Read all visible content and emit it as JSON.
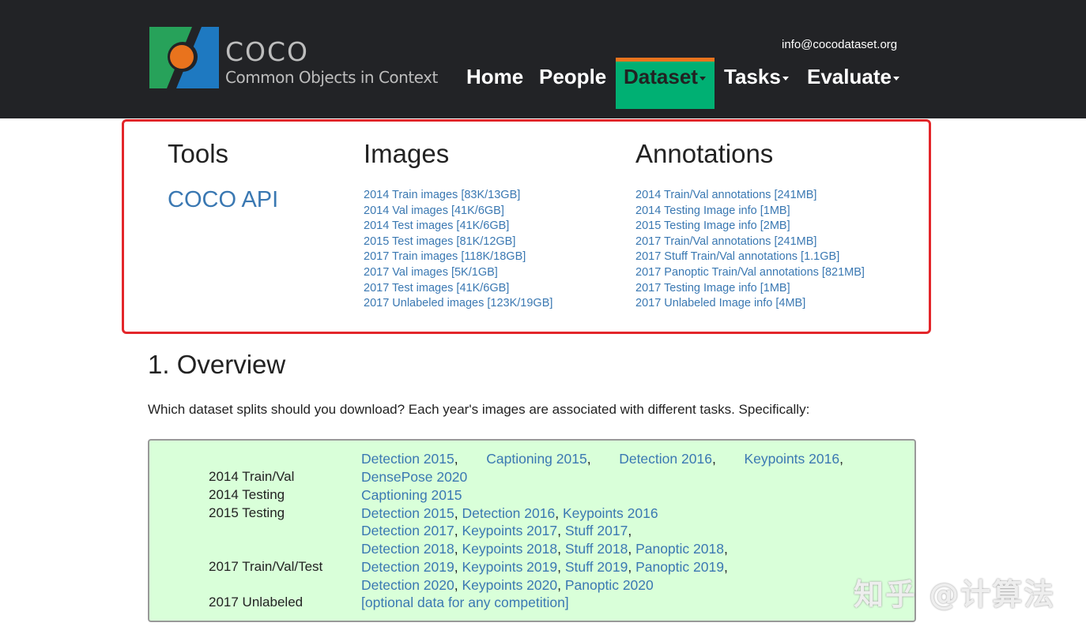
{
  "brand": {
    "name": "COCO",
    "tagline": "Common Objects in Context"
  },
  "header": {
    "email": "info@cocodataset.org"
  },
  "nav": {
    "items": [
      {
        "label": "Home",
        "dropdown": false
      },
      {
        "label": "People",
        "dropdown": false
      },
      {
        "label": "Dataset",
        "dropdown": true,
        "active": true
      },
      {
        "label": "Tasks",
        "dropdown": true
      },
      {
        "label": "Evaluate",
        "dropdown": true
      }
    ]
  },
  "downloads": {
    "tools": {
      "heading": "Tools",
      "link": "COCO API"
    },
    "images": {
      "heading": "Images",
      "links": [
        "2014 Train images [83K/13GB]",
        "2014 Val images [41K/6GB]",
        "2014 Test images [41K/6GB]",
        "2015 Test images [81K/12GB]",
        "2017 Train images [118K/18GB]",
        "2017 Val images [5K/1GB]",
        "2017 Test images [41K/6GB]",
        "2017 Unlabeled images [123K/19GB]"
      ]
    },
    "annotations": {
      "heading": "Annotations",
      "links": [
        "2014 Train/Val annotations [241MB]",
        "2014 Testing Image info [1MB]",
        "2015 Testing Image info [2MB]",
        "2017 Train/Val annotations [241MB]",
        "2017 Stuff Train/Val annotations [1.1GB]",
        "2017 Panoptic Train/Val annotations [821MB]",
        "2017 Testing Image info [1MB]",
        "2017 Unlabeled Image info [4MB]"
      ]
    }
  },
  "overview": {
    "title": "1. Overview",
    "text": "Which dataset splits should you download? Each year's images are associated with different tasks. Specifically:",
    "splits": [
      {
        "label": "2014 Train/Val",
        "tasks": [
          "Detection 2015",
          "Captioning 2015",
          "Detection 2016",
          "Keypoints 2016",
          "DensePose 2020"
        ]
      },
      {
        "label": "2014 Testing",
        "tasks": [
          "Captioning 2015"
        ]
      },
      {
        "label": "2015 Testing",
        "tasks": [
          "Detection 2015",
          "Detection 2016",
          "Keypoints 2016"
        ]
      },
      {
        "label": "2017 Train/Val/Test",
        "tasks": [
          "Detection 2017",
          "Keypoints 2017",
          "Stuff 2017",
          "Detection 2018",
          "Keypoints 2018",
          "Stuff 2018",
          "Panoptic 2018",
          "Detection 2019",
          "Keypoints 2019",
          "Stuff 2019",
          "Panoptic 2019",
          "Detection 2020",
          "Keypoints 2020",
          "Panoptic 2020"
        ]
      },
      {
        "label": "2017 Unlabeled",
        "tasks": [
          "[optional data for any competition]"
        ]
      }
    ]
  },
  "watermark": "知乎 @计算法",
  "colors": {
    "navbar_bg": "#222326",
    "active_nav_bg": "#00b073",
    "active_nav_top": "#e9731d",
    "link": "#3a78b2",
    "split_bg": "#d9ffd9",
    "highlight_box": "#e3262a"
  }
}
